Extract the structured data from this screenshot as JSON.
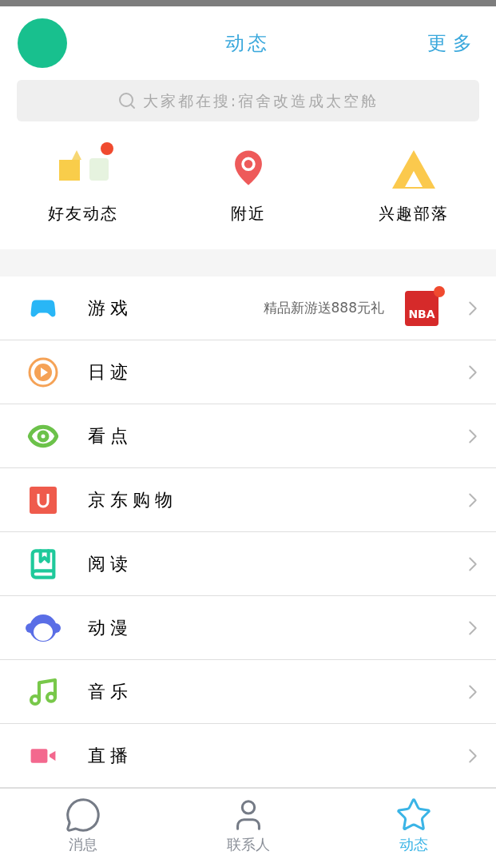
{
  "header": {
    "title": "动态",
    "more": "更多"
  },
  "search": {
    "placeholder": "大家都在搜:宿舍改造成太空舱"
  },
  "shortcuts": [
    {
      "label": "好友动态",
      "kind": "friends",
      "badge": true
    },
    {
      "label": "附近",
      "kind": "location",
      "badge": false
    },
    {
      "label": "兴趣部落",
      "kind": "tent",
      "badge": false
    }
  ],
  "rows": [
    {
      "label": "游戏",
      "kind": "game",
      "promo": "精品新游送888元礼",
      "promo_icon": "NBA",
      "badge": true
    },
    {
      "label": "日迹",
      "kind": "play",
      "badge": false
    },
    {
      "label": "看点",
      "kind": "eye",
      "badge": false
    },
    {
      "label": "京东购物",
      "kind": "shop",
      "badge": false
    },
    {
      "label": "阅读",
      "kind": "book",
      "badge": false
    },
    {
      "label": "动漫",
      "kind": "anime",
      "badge": false
    },
    {
      "label": "音乐",
      "kind": "music",
      "badge": false
    },
    {
      "label": "直播",
      "kind": "video",
      "badge": false
    }
  ],
  "tabs": [
    {
      "label": "消息",
      "kind": "chat",
      "selected": false
    },
    {
      "label": "联系人",
      "kind": "contact",
      "selected": false
    },
    {
      "label": "动态",
      "kind": "star",
      "selected": true
    }
  ]
}
